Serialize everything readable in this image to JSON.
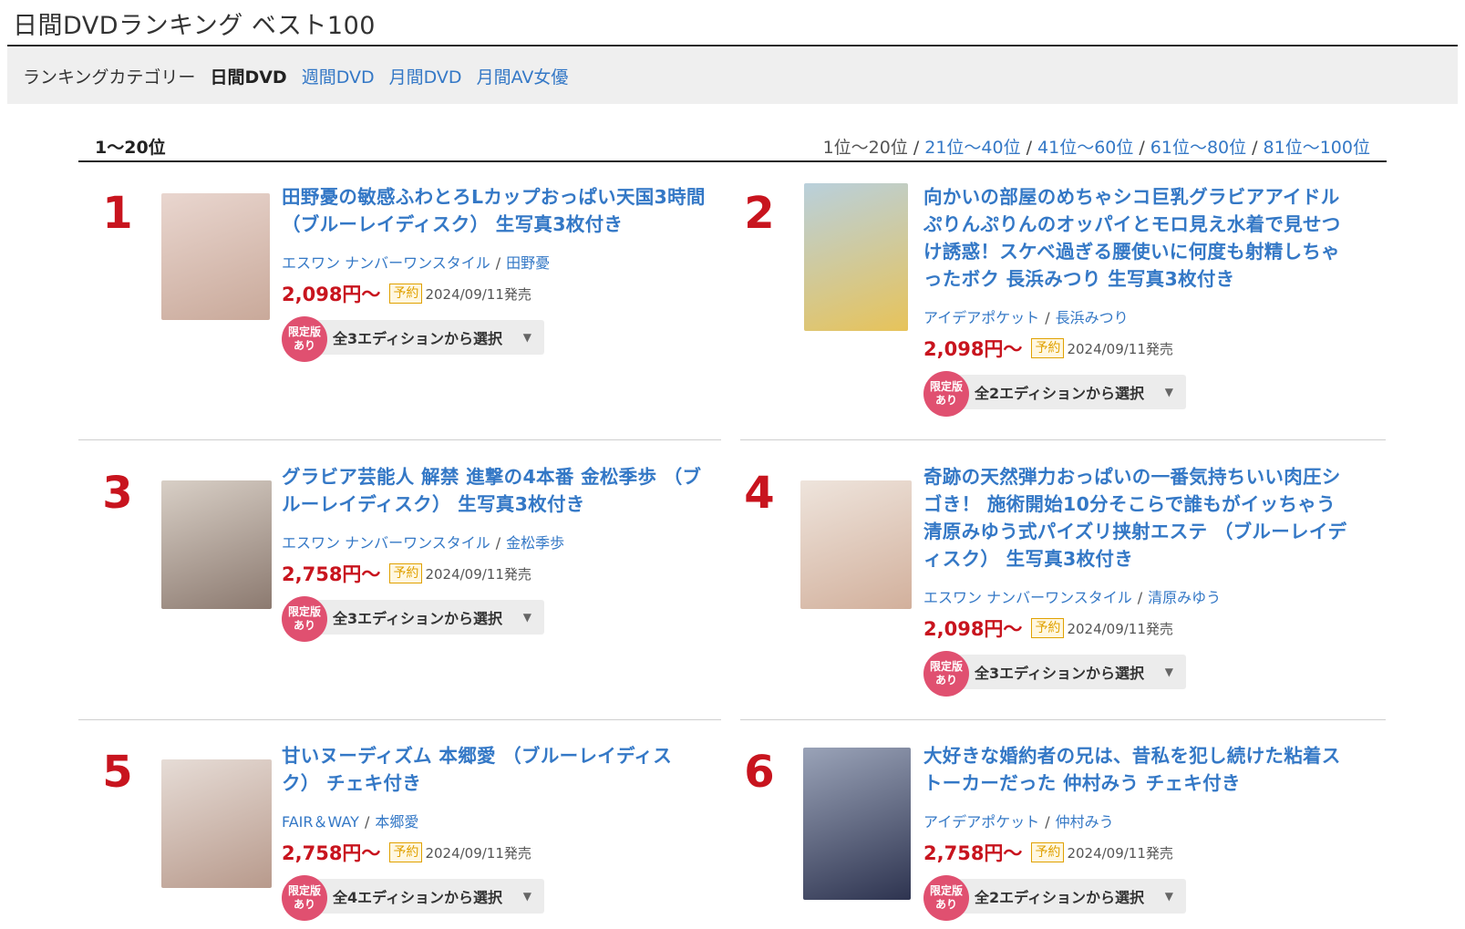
{
  "page": {
    "title": "日間DVDランキング ベスト100"
  },
  "categories": {
    "label": "ランキングカテゴリー",
    "current": "日間DVD",
    "links": [
      "週間DVD",
      "月間DVD",
      "月間AV女優"
    ]
  },
  "range": {
    "current": "1〜20位",
    "pager_current": "1位〜20位",
    "pager_links": [
      "21位〜40位",
      "41位〜60位",
      "61位〜80位",
      "81位〜100位"
    ],
    "separator": "/"
  },
  "items": [
    {
      "rank": "1",
      "title": "田野憂の敏感ふわとろLカップおっぱい天国3時間（ブルーレイディスク） 生写真3枚付き",
      "maker": "エスワン ナンバーワンスタイル",
      "actress": "田野憂",
      "price": "2,098円〜",
      "badge": "予約",
      "date": "2024/09/11発売",
      "limited": [
        "限定版",
        "あり"
      ],
      "edition": "全3エディションから選択",
      "thumb_colors": [
        "#e9d6cf",
        "#c9a99a"
      ]
    },
    {
      "rank": "2",
      "title": "向かいの部屋のめちゃシコ巨乳グラビアアイドルぷりんぷりんのオッパイとモロ見え水着で見せつけ誘惑！スケベ過ぎる腰使いに何度も射精しちゃったボク 長浜みつり 生写真3枚付き",
      "maker": "アイデアポケット",
      "actress": "長浜みつり",
      "price": "2,098円〜",
      "badge": "予約",
      "date": "2024/09/11発売",
      "limited": [
        "限定版",
        "あり"
      ],
      "edition": "全2エディションから選択",
      "thumb_colors": [
        "#b9d0dc",
        "#e7c35a"
      ]
    },
    {
      "rank": "3",
      "title": "グラビア芸能人 解禁 進撃の4本番 金松季歩 （ブルーレイディスク） 生写真3枚付き",
      "maker": "エスワン ナンバーワンスタイル",
      "actress": "金松季歩",
      "price": "2,758円〜",
      "badge": "予約",
      "date": "2024/09/11発売",
      "limited": [
        "限定版",
        "あり"
      ],
      "edition": "全3エディションから選択",
      "thumb_colors": [
        "#d8cfc6",
        "#8c7a70"
      ]
    },
    {
      "rank": "4",
      "title": "奇跡の天然弾力おっぱいの一番気持ちいい肉圧シゴき！ 施術開始10分そこらで誰もがイッちゃう清原みゆう式パイズリ挟射エステ （ブルーレイディスク） 生写真3枚付き",
      "maker": "エスワン ナンバーワンスタイル",
      "actress": "清原みゆう",
      "price": "2,098円〜",
      "badge": "予約",
      "date": "2024/09/11発売",
      "limited": [
        "限定版",
        "あり"
      ],
      "edition": "全3エディションから選択",
      "thumb_colors": [
        "#eee4dc",
        "#d2b09c"
      ]
    },
    {
      "rank": "5",
      "title": "甘いヌーディズム 本郷愛 （ブルーレイディスク） チェキ付き",
      "maker": "FAIR＆WAY",
      "actress": "本郷愛",
      "price": "2,758円〜",
      "badge": "予約",
      "date": "2024/09/11発売",
      "limited": [
        "限定版",
        "あり"
      ],
      "edition": "全4エディションから選択",
      "thumb_colors": [
        "#e6dcd6",
        "#b89a8c"
      ]
    },
    {
      "rank": "6",
      "title": "大好きな婚約者の兄は、昔私を犯し続けた粘着ストーカーだった 仲村みう チェキ付き",
      "maker": "アイデアポケット",
      "actress": "仲村みう",
      "price": "2,758円〜",
      "badge": "予約",
      "date": "2024/09/11発売",
      "limited": [
        "限定版",
        "あり"
      ],
      "edition": "全2エディションから選択",
      "thumb_colors": [
        "#9aa3b8",
        "#2e3450"
      ]
    }
  ]
}
